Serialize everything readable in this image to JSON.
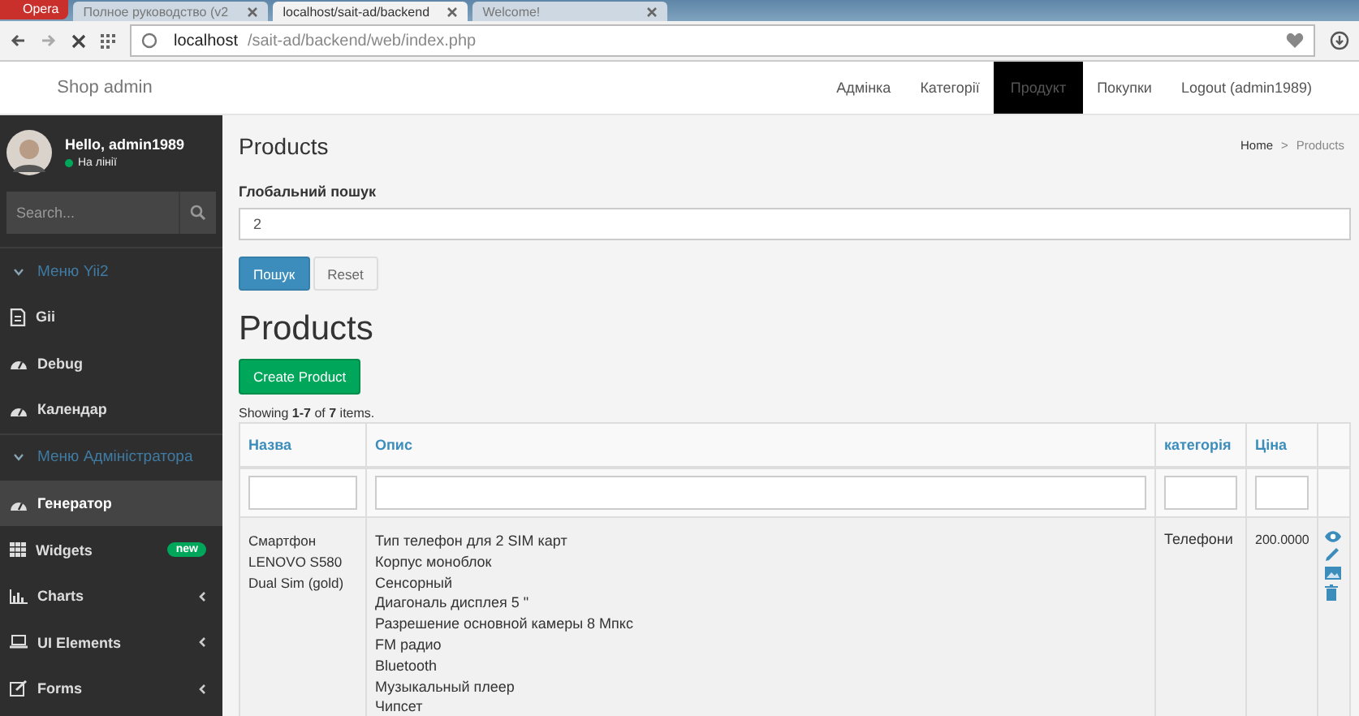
{
  "browser": {
    "opera_button": "Opera",
    "tabs": [
      {
        "title": "Полное руководство (v2",
        "selected": false
      },
      {
        "title": "localhost/sait-ad/backend",
        "selected": true
      },
      {
        "title": "Welcome!",
        "selected": false
      }
    ],
    "url_host": "localhost",
    "url_path": "/sait-ad/backend/web/index.php"
  },
  "brand": "Shop admin",
  "navbar": [
    {
      "label": "Адмінка",
      "selected": false
    },
    {
      "label": "Категорії",
      "selected": false
    },
    {
      "label": "Продукт",
      "selected": true
    },
    {
      "label": "Покупки",
      "selected": false
    },
    {
      "label": "Logout (admin1989)",
      "selected": false
    }
  ],
  "sidebar": {
    "user": "Hello, admin1989",
    "status": "На лінії",
    "search_placeholder": "Search...",
    "items": [
      {
        "kind": "header",
        "label": "Меню Yii2",
        "expanded": true
      },
      {
        "kind": "item",
        "label": "Gii",
        "selected": false
      },
      {
        "kind": "item",
        "label": "Debug",
        "selected": false
      },
      {
        "kind": "item",
        "label": "Календар",
        "selected": false
      },
      {
        "kind": "header",
        "label": "Меню Адміністратора",
        "expanded": true
      },
      {
        "kind": "item",
        "label": "Генератор",
        "selected": true
      },
      {
        "kind": "item",
        "label": "Widgets",
        "selected": false,
        "badge": "new"
      },
      {
        "kind": "item",
        "label": "Charts",
        "selected": false,
        "submenu": true
      },
      {
        "kind": "item",
        "label": "UI Elements",
        "selected": false,
        "submenu": true
      },
      {
        "kind": "item",
        "label": "Forms",
        "selected": false,
        "submenu": true
      }
    ]
  },
  "page_title": "Products",
  "breadcrumb": [
    "Home",
    "Products"
  ],
  "breadcrumb_separator": ">",
  "search": {
    "label": "Глобальний пошук",
    "value": "2",
    "submit": "Пошук",
    "reset": "Reset"
  },
  "heading": "Products",
  "create_button": "Create Product",
  "summary": "Showing **1-7** of **7** items.",
  "table": {
    "columns": [
      "Назва",
      "Опис",
      "категорія",
      "Ціна"
    ],
    "rows": [
      {
        "name": [
          "Смартфон",
          "LENOVO S580",
          "Dual Sim (gold)"
        ],
        "description": [
          "Тип телефон для 2 SIM карт",
          "Корпус моноблок",
          "Сенсорный",
          "Диагональ дисплея 5 \"",
          "Разрешение основной камеры 8 Мпкс",
          "FM радио",
          "Bluetooth",
          "Музыкальный плеер",
          "Чипсет"
        ],
        "category": "Телефони",
        "price": "200.0000"
      }
    ]
  }
}
